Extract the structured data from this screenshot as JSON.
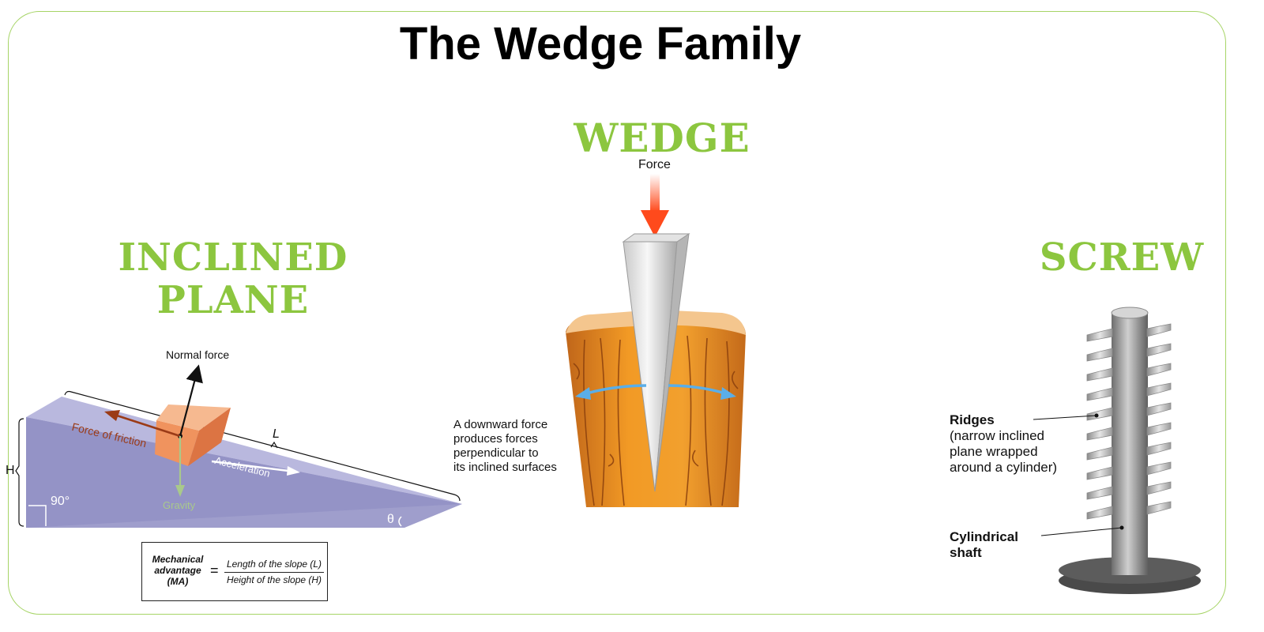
{
  "title": "The Wedge Family",
  "inclined_plane": {
    "heading_line1": "INCLINED",
    "heading_line2": "PLANE",
    "normal_force": "Normal force",
    "force_of_friction": "Force of friction",
    "acceleration": "Acceleration",
    "gravity": "Gravity",
    "length": "L",
    "height": "H",
    "angle_right": "90°",
    "angle_theta": "θ",
    "formula": {
      "left_line1": "Mechanical",
      "left_line2": "advantage",
      "left_line3": "(MA)",
      "equals": "=",
      "numerator": "Length of the slope (L)",
      "denominator": "Height of  the slope (H)"
    }
  },
  "wedge": {
    "heading": "WEDGE",
    "force": "Force",
    "description_line1": "A downward force",
    "description_line2": "produces forces",
    "description_line3": "perpendicular to",
    "description_line4": "its inclined surfaces"
  },
  "screw": {
    "heading": "SCREW",
    "ridges_title": "Ridges",
    "ridges_line1": "(narrow inclined",
    "ridges_line2": "plane wrapped",
    "ridges_line3": "around a cylinder)",
    "shaft_line1": "Cylindrical",
    "shaft_line2": "shaft"
  },
  "colors": {
    "accent_green": "#8cc63f",
    "incline_purple": "#9593c6",
    "wood_orange": "#e8871c",
    "force_red": "#ff4a1c",
    "arrow_blue": "#5aaee8",
    "friction_brown": "#9b3b17",
    "gravity_green": "#a9c98b"
  }
}
